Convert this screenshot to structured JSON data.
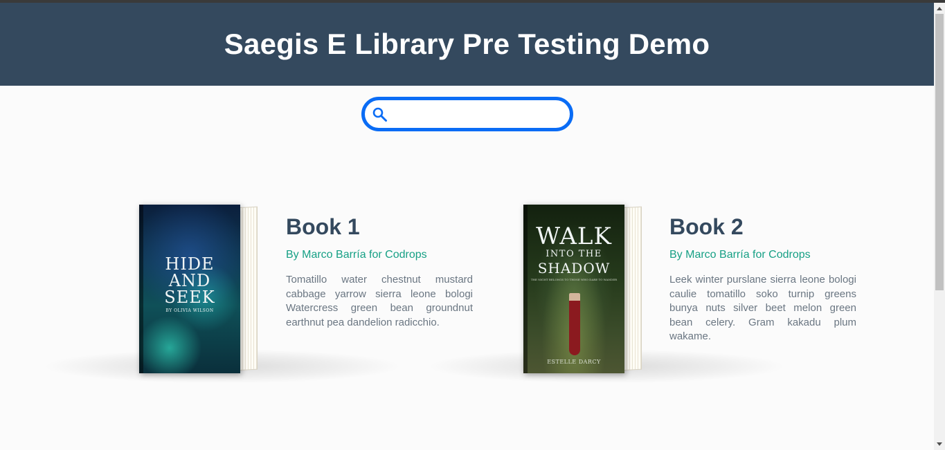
{
  "header": {
    "title": "Saegis E Library Pre Testing Demo"
  },
  "search": {
    "placeholder": "",
    "value": "",
    "icon": "search-icon",
    "border_color": "#0a6cf5"
  },
  "colors": {
    "header_bg": "#34495e",
    "title_color": "#34495e",
    "byline_color": "#16a085",
    "text_color": "#6a7682"
  },
  "books": [
    {
      "title": "Book 1",
      "byline": "By Marco Barría for Codrops",
      "description": "Tomatillo water chestnut mustard cabbage yarrow sierra leone bologi Watercress green bean groundnut earthnut pea dandelion radicchio.",
      "cover": {
        "title_line1": "HIDE",
        "title_line2": "AND",
        "title_line3": "SEEK",
        "author": "BY OLIVIA WILSON"
      }
    },
    {
      "title": "Book 2",
      "byline": "By Marco Barría for Codrops",
      "description": "Leek winter purslane sierra leone bologi caulie tomatillo soko turnip greens bunya nuts silver beet melon green bean celery. Gram kakadu plum wakame.",
      "cover": {
        "title_line1": "WALK",
        "title_line2": "INTO THE",
        "title_line3": "SHADOW",
        "tagline": "THE NIGHT BELONGS TO THOSE WHO DARE TO WANDER",
        "author": "ESTELLE DARCY"
      }
    }
  ]
}
